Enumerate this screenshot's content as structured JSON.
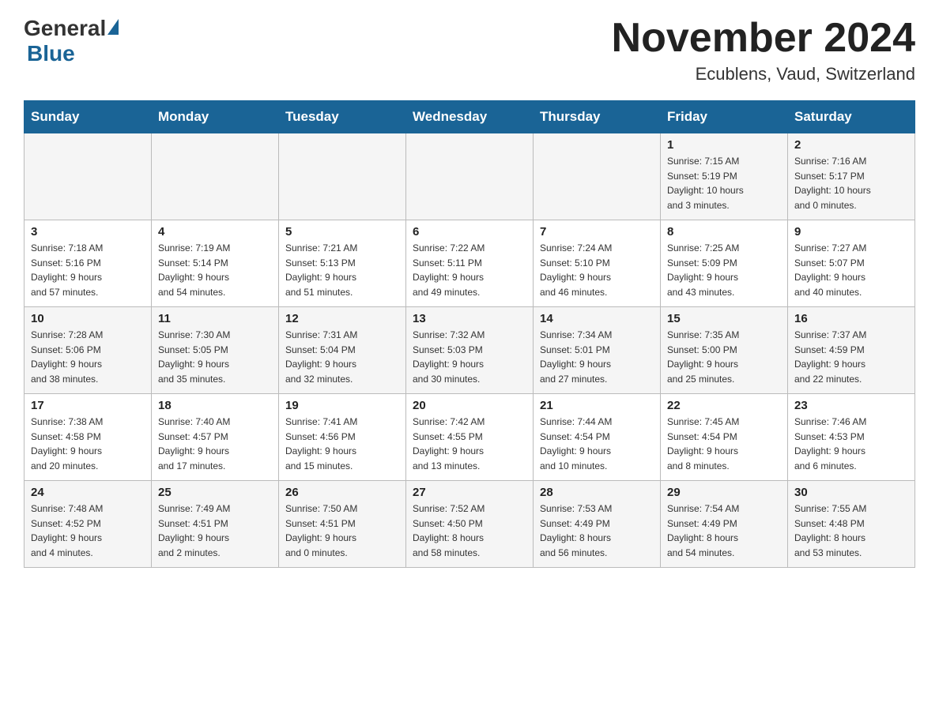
{
  "header": {
    "logo": {
      "general": "General",
      "blue": "Blue"
    },
    "title": "November 2024",
    "location": "Ecublens, Vaud, Switzerland"
  },
  "calendar": {
    "days_of_week": [
      "Sunday",
      "Monday",
      "Tuesday",
      "Wednesday",
      "Thursday",
      "Friday",
      "Saturday"
    ],
    "weeks": [
      [
        {
          "day": "",
          "info": ""
        },
        {
          "day": "",
          "info": ""
        },
        {
          "day": "",
          "info": ""
        },
        {
          "day": "",
          "info": ""
        },
        {
          "day": "",
          "info": ""
        },
        {
          "day": "1",
          "info": "Sunrise: 7:15 AM\nSunset: 5:19 PM\nDaylight: 10 hours\nand 3 minutes."
        },
        {
          "day": "2",
          "info": "Sunrise: 7:16 AM\nSunset: 5:17 PM\nDaylight: 10 hours\nand 0 minutes."
        }
      ],
      [
        {
          "day": "3",
          "info": "Sunrise: 7:18 AM\nSunset: 5:16 PM\nDaylight: 9 hours\nand 57 minutes."
        },
        {
          "day": "4",
          "info": "Sunrise: 7:19 AM\nSunset: 5:14 PM\nDaylight: 9 hours\nand 54 minutes."
        },
        {
          "day": "5",
          "info": "Sunrise: 7:21 AM\nSunset: 5:13 PM\nDaylight: 9 hours\nand 51 minutes."
        },
        {
          "day": "6",
          "info": "Sunrise: 7:22 AM\nSunset: 5:11 PM\nDaylight: 9 hours\nand 49 minutes."
        },
        {
          "day": "7",
          "info": "Sunrise: 7:24 AM\nSunset: 5:10 PM\nDaylight: 9 hours\nand 46 minutes."
        },
        {
          "day": "8",
          "info": "Sunrise: 7:25 AM\nSunset: 5:09 PM\nDaylight: 9 hours\nand 43 minutes."
        },
        {
          "day": "9",
          "info": "Sunrise: 7:27 AM\nSunset: 5:07 PM\nDaylight: 9 hours\nand 40 minutes."
        }
      ],
      [
        {
          "day": "10",
          "info": "Sunrise: 7:28 AM\nSunset: 5:06 PM\nDaylight: 9 hours\nand 38 minutes."
        },
        {
          "day": "11",
          "info": "Sunrise: 7:30 AM\nSunset: 5:05 PM\nDaylight: 9 hours\nand 35 minutes."
        },
        {
          "day": "12",
          "info": "Sunrise: 7:31 AM\nSunset: 5:04 PM\nDaylight: 9 hours\nand 32 minutes."
        },
        {
          "day": "13",
          "info": "Sunrise: 7:32 AM\nSunset: 5:03 PM\nDaylight: 9 hours\nand 30 minutes."
        },
        {
          "day": "14",
          "info": "Sunrise: 7:34 AM\nSunset: 5:01 PM\nDaylight: 9 hours\nand 27 minutes."
        },
        {
          "day": "15",
          "info": "Sunrise: 7:35 AM\nSunset: 5:00 PM\nDaylight: 9 hours\nand 25 minutes."
        },
        {
          "day": "16",
          "info": "Sunrise: 7:37 AM\nSunset: 4:59 PM\nDaylight: 9 hours\nand 22 minutes."
        }
      ],
      [
        {
          "day": "17",
          "info": "Sunrise: 7:38 AM\nSunset: 4:58 PM\nDaylight: 9 hours\nand 20 minutes."
        },
        {
          "day": "18",
          "info": "Sunrise: 7:40 AM\nSunset: 4:57 PM\nDaylight: 9 hours\nand 17 minutes."
        },
        {
          "day": "19",
          "info": "Sunrise: 7:41 AM\nSunset: 4:56 PM\nDaylight: 9 hours\nand 15 minutes."
        },
        {
          "day": "20",
          "info": "Sunrise: 7:42 AM\nSunset: 4:55 PM\nDaylight: 9 hours\nand 13 minutes."
        },
        {
          "day": "21",
          "info": "Sunrise: 7:44 AM\nSunset: 4:54 PM\nDaylight: 9 hours\nand 10 minutes."
        },
        {
          "day": "22",
          "info": "Sunrise: 7:45 AM\nSunset: 4:54 PM\nDaylight: 9 hours\nand 8 minutes."
        },
        {
          "day": "23",
          "info": "Sunrise: 7:46 AM\nSunset: 4:53 PM\nDaylight: 9 hours\nand 6 minutes."
        }
      ],
      [
        {
          "day": "24",
          "info": "Sunrise: 7:48 AM\nSunset: 4:52 PM\nDaylight: 9 hours\nand 4 minutes."
        },
        {
          "day": "25",
          "info": "Sunrise: 7:49 AM\nSunset: 4:51 PM\nDaylight: 9 hours\nand 2 minutes."
        },
        {
          "day": "26",
          "info": "Sunrise: 7:50 AM\nSunset: 4:51 PM\nDaylight: 9 hours\nand 0 minutes."
        },
        {
          "day": "27",
          "info": "Sunrise: 7:52 AM\nSunset: 4:50 PM\nDaylight: 8 hours\nand 58 minutes."
        },
        {
          "day": "28",
          "info": "Sunrise: 7:53 AM\nSunset: 4:49 PM\nDaylight: 8 hours\nand 56 minutes."
        },
        {
          "day": "29",
          "info": "Sunrise: 7:54 AM\nSunset: 4:49 PM\nDaylight: 8 hours\nand 54 minutes."
        },
        {
          "day": "30",
          "info": "Sunrise: 7:55 AM\nSunset: 4:48 PM\nDaylight: 8 hours\nand 53 minutes."
        }
      ]
    ]
  }
}
